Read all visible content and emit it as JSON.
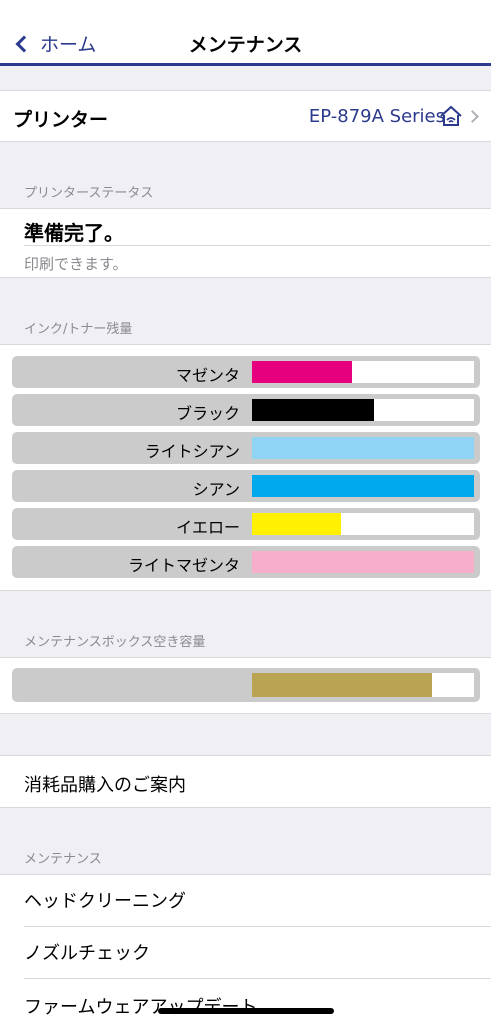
{
  "nav": {
    "back_label": "ホーム",
    "title": "メンテナンス"
  },
  "printer": {
    "label": "プリンター",
    "value": "EP-879A Series"
  },
  "status": {
    "header": "プリンターステータス",
    "title": "準備完了。",
    "subtitle": "印刷できます。"
  },
  "ink": {
    "header": "インク/トナー残量",
    "items": [
      {
        "label": "マゼンタ",
        "level": 0.45,
        "color": "#e6007e"
      },
      {
        "label": "ブラック",
        "level": 0.55,
        "color": "#000000"
      },
      {
        "label": "ライトシアン",
        "level": 1.0,
        "color": "#8fd4f5"
      },
      {
        "label": "シアン",
        "level": 1.0,
        "color": "#00a9ec"
      },
      {
        "label": "イエロー",
        "level": 0.4,
        "color": "#fff100"
      },
      {
        "label": "ライトマゼンタ",
        "level": 1.0,
        "color": "#f6aecb"
      }
    ]
  },
  "maintenance_box": {
    "header": "メンテナンスボックス空き容量",
    "level": 0.81,
    "color": "#b8a452"
  },
  "purchase": {
    "label": "消耗品購入のご案内"
  },
  "maintenance": {
    "header": "メンテナンス",
    "items": [
      {
        "label": "ヘッドクリーニング"
      },
      {
        "label": "ノズルチェック"
      },
      {
        "label": "ファームウェアアップデート"
      }
    ]
  },
  "colors": {
    "accent": "#2b3a8c"
  }
}
